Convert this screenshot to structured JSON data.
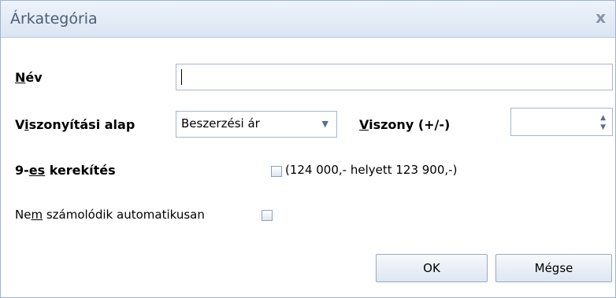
{
  "dialog": {
    "title": "Árkategória",
    "close_symbol": "x"
  },
  "fields": {
    "name_label_mnemonic": "N",
    "name_label_rest": "év",
    "name_value": "",
    "comparison_label_pre": "V",
    "comparison_label_mnemonic": "i",
    "comparison_label_rest": "szonyítási alap",
    "comparison_selected": "Beszerzési ár",
    "ratio_label_mnemonic": "V",
    "ratio_label_rest": "iszony (+/-)",
    "ratio_value": "",
    "rounding_label_pre": "9-",
    "rounding_label_mnemonic": "es",
    "rounding_label_rest": " kerekítés",
    "rounding_checked": false,
    "rounding_hint": "(124 000,- helyett 123 900,-)",
    "auto_label_pre": "Ne",
    "auto_label_mnemonic": "m",
    "auto_label_rest": " számolódik automatikusan",
    "auto_checked": false
  },
  "buttons": {
    "ok": "OK",
    "cancel": "Mégse"
  },
  "icons": {
    "dropdown": "chevron-down-icon",
    "spin": "spin-arrows-icon"
  }
}
